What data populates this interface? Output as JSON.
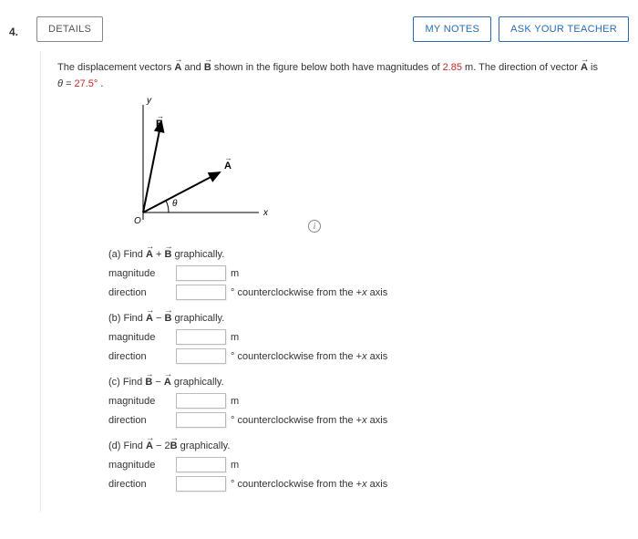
{
  "question_number": "4.",
  "buttons": {
    "details": "DETAILS",
    "my_notes": "MY NOTES",
    "ask_teacher": "ASK YOUR TEACHER"
  },
  "problem": {
    "prefix": "The displacement vectors ",
    "vec_a": "A",
    "mid1": " and ",
    "vec_b": "B",
    "mid2": " shown in the figure below both have magnitudes of ",
    "magnitude": "2.85",
    "mid3": " m. The direction of vector ",
    "vec_a2": "A",
    "mid4": " is ",
    "theta_line_prefix": "θ = ",
    "theta_value": "27.5°",
    "theta_suffix": "."
  },
  "figure": {
    "x_label": "x",
    "y_label": "y",
    "origin": "O",
    "theta": "θ",
    "vecA": "A",
    "vecB": "B"
  },
  "labels": {
    "magnitude": "magnitude",
    "direction": "direction",
    "m": "m",
    "deg_suffix": "° counterclockwise from the +",
    "axis_var": "x",
    "axis_suffix": " axis"
  },
  "parts": [
    {
      "id": "a",
      "label_prefix": "(a) Find ",
      "expr_left": "A",
      "op": " + ",
      "expr_right": "B",
      "coef_right": "",
      "label_suffix": " graphically."
    },
    {
      "id": "b",
      "label_prefix": "(b) Find ",
      "expr_left": "A",
      "op": " − ",
      "expr_right": "B",
      "coef_right": "",
      "label_suffix": " graphically."
    },
    {
      "id": "c",
      "label_prefix": "(c) Find ",
      "expr_left": "B",
      "op": " − ",
      "expr_right": "A",
      "coef_right": "",
      "label_suffix": " graphically."
    },
    {
      "id": "d",
      "label_prefix": "(d) Find ",
      "expr_left": "A",
      "op": " − 2",
      "expr_right": "B",
      "coef_right": "",
      "label_suffix": " graphically."
    }
  ]
}
